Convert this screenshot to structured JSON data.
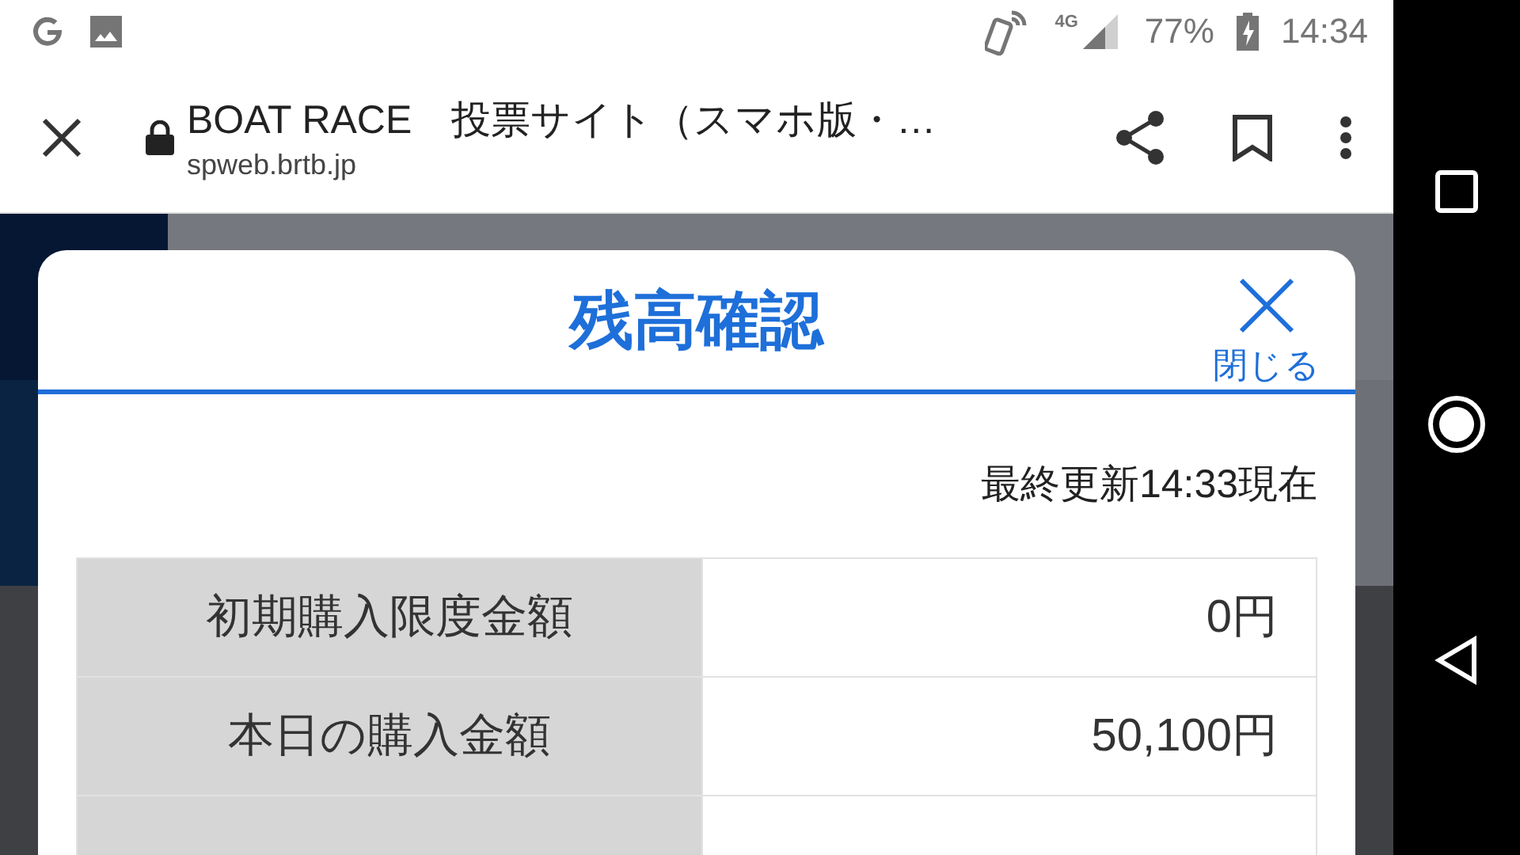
{
  "status_bar": {
    "network": "4G",
    "battery": "77%",
    "time": "14:34"
  },
  "browser": {
    "page_title": "BOAT RACE　投票サイト（スマホ版・…",
    "url": "spweb.brtb.jp"
  },
  "dialog": {
    "title": "残高確認",
    "close_label": "閉じる",
    "updated": "最終更新14:33現在",
    "rows": [
      {
        "label": "初期購入限度金額",
        "value": "0円"
      },
      {
        "label": "本日の購入金額",
        "value": "50,100円"
      }
    ]
  }
}
